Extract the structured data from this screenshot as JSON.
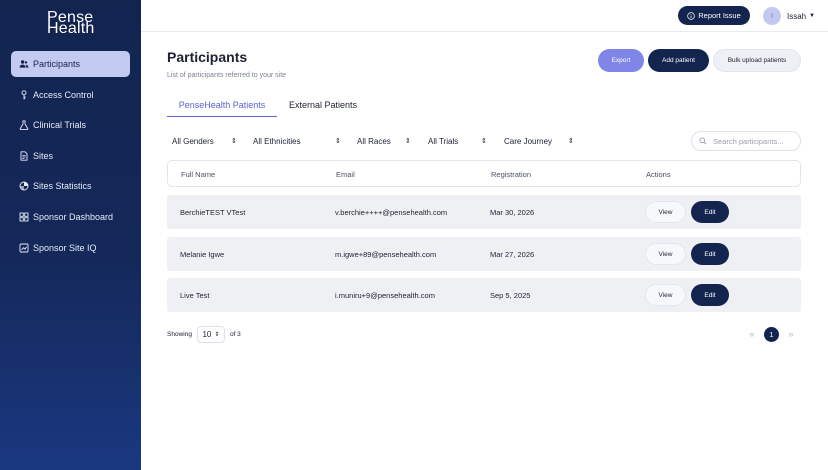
{
  "brand": {
    "logo_line1": "Pense",
    "logo_line2": "Health"
  },
  "sidebar": {
    "items": [
      {
        "label": "Participants",
        "icon": "users-icon",
        "active": true
      },
      {
        "label": "Access Control",
        "icon": "key-icon",
        "active": false
      },
      {
        "label": "Clinical Trials",
        "icon": "flask-icon",
        "active": false
      },
      {
        "label": "Sites",
        "icon": "document-icon",
        "active": false
      },
      {
        "label": "Sites Statistics",
        "icon": "pie-chart-icon",
        "active": false
      },
      {
        "label": "Sponsor Dashboard",
        "icon": "grid-icon",
        "active": false
      },
      {
        "label": "Sponsor Site IQ",
        "icon": "chart-icon",
        "active": false
      }
    ]
  },
  "topbar": {
    "report_label": "Report Issue",
    "report_icon": "info-icon",
    "avatar_initial": "I",
    "username": "Issah",
    "caret": "▼"
  },
  "header": {
    "title": "Participants",
    "subtitle": "List of participants referred to your site",
    "export_label": "Export",
    "add_label": "Add patient",
    "bulk_label": "Bulk upload patients"
  },
  "tabs": [
    {
      "label": "PenseHealth Patients",
      "active": true
    },
    {
      "label": "External Patients",
      "active": false
    }
  ],
  "filters": {
    "genders": "All Genders",
    "ethnicities": "All Ethnicities",
    "races": "All Races",
    "trials": "All Trials",
    "journey": "Care Journey",
    "search_placeholder": "Search participants..."
  },
  "table": {
    "columns": [
      "Full Name",
      "Email",
      "Registration",
      "Actions"
    ],
    "rows": [
      {
        "name": "BerchieTEST VTest",
        "email": "v.berchie++++@pensehealth.com",
        "registration": "Mar 30, 2026"
      },
      {
        "name": "Melanie Igwe",
        "email": "m.igwe+89@pensehealth.com",
        "registration": "Mar 27, 2026"
      },
      {
        "name": "Live Test",
        "email": "i.muniru+9@pensehealth.com",
        "registration": "Sep 5, 2025"
      }
    ],
    "view_label": "View",
    "edit_label": "Edit"
  },
  "pagination": {
    "showing_label": "Showing",
    "per_page": "10",
    "of_label": "of 3",
    "prev": "«",
    "current": "1",
    "next": "»"
  },
  "colors": {
    "sidebar": "#13244f",
    "accent": "#5a64d6",
    "export": "#7f86e8",
    "active_nav": "#c4cbf3"
  }
}
